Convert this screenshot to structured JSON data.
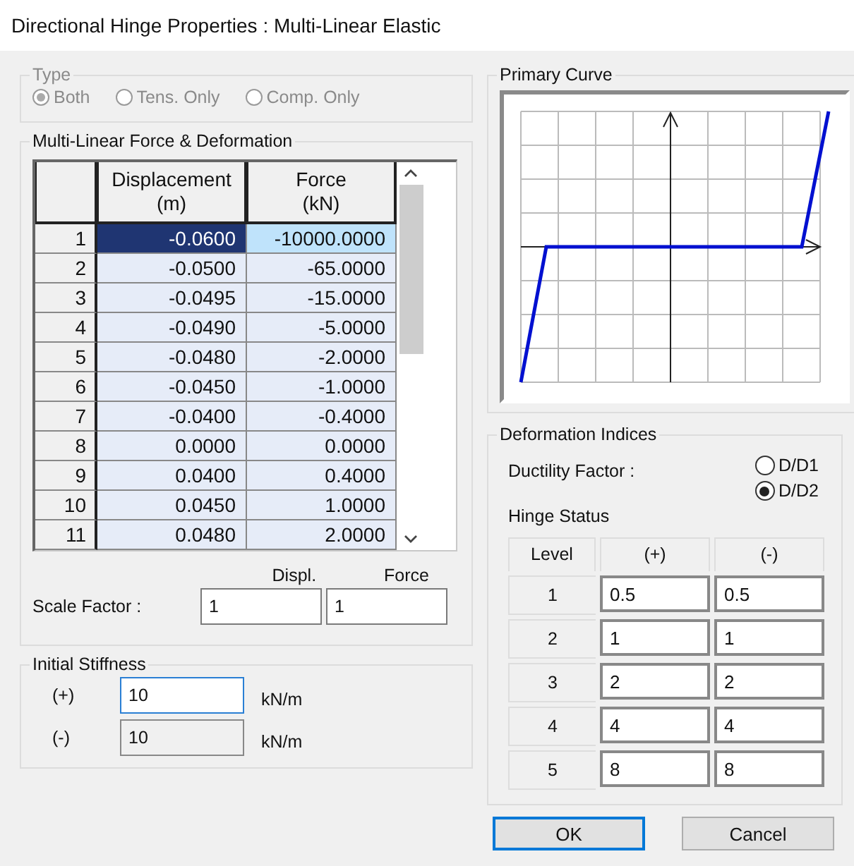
{
  "window": {
    "title": "Directional Hinge Properties : Multi-Linear Elastic"
  },
  "type_group": {
    "title": "Type",
    "disabled": true,
    "options": [
      {
        "label": "Both",
        "selected": true
      },
      {
        "label": "Tens. Only",
        "selected": false
      },
      {
        "label": "Comp. Only",
        "selected": false
      }
    ]
  },
  "table": {
    "title": "Multi-Linear Force & Deformation",
    "columns": [
      {
        "name": "Displacement",
        "unit": "(m)"
      },
      {
        "name": "Force",
        "unit": "(kN)"
      }
    ],
    "rows": [
      {
        "index": "1",
        "selected": true,
        "cells": [
          {
            "text": "-0.0600",
            "selected": true
          },
          {
            "text": "-10000.0000",
            "selected": false
          }
        ]
      },
      {
        "index": "2",
        "selected": false,
        "cells": [
          {
            "text": "-0.0500",
            "selected": false
          },
          {
            "text": "-65.0000",
            "selected": false
          }
        ]
      },
      {
        "index": "3",
        "selected": false,
        "cells": [
          {
            "text": "-0.0495",
            "selected": false
          },
          {
            "text": "-15.0000",
            "selected": false
          }
        ]
      },
      {
        "index": "4",
        "selected": false,
        "cells": [
          {
            "text": "-0.0490",
            "selected": false
          },
          {
            "text": "-5.0000",
            "selected": false
          }
        ]
      },
      {
        "index": "5",
        "selected": false,
        "cells": [
          {
            "text": "-0.0480",
            "selected": false
          },
          {
            "text": "-2.0000",
            "selected": false
          }
        ]
      },
      {
        "index": "6",
        "selected": false,
        "cells": [
          {
            "text": "-0.0450",
            "selected": false
          },
          {
            "text": "-1.0000",
            "selected": false
          }
        ]
      },
      {
        "index": "7",
        "selected": false,
        "cells": [
          {
            "text": "-0.0400",
            "selected": false
          },
          {
            "text": "-0.4000",
            "selected": false
          }
        ]
      },
      {
        "index": "8",
        "selected": false,
        "cells": [
          {
            "text": "0.0000",
            "selected": false
          },
          {
            "text": "0.0000",
            "selected": false
          }
        ]
      },
      {
        "index": "9",
        "selected": false,
        "cells": [
          {
            "text": "0.0400",
            "selected": false
          },
          {
            "text": "0.4000",
            "selected": false
          }
        ]
      },
      {
        "index": "10",
        "selected": false,
        "cells": [
          {
            "text": "0.0450",
            "selected": false
          },
          {
            "text": "1.0000",
            "selected": false
          }
        ]
      },
      {
        "index": "11",
        "selected": false,
        "cells": [
          {
            "text": "0.0480",
            "selected": false
          },
          {
            "text": "2.0000",
            "selected": false
          }
        ]
      }
    ]
  },
  "scale_factor": {
    "label": "Scale Factor :",
    "columns": [
      "Displ.",
      "Force"
    ],
    "values": [
      "1",
      "1"
    ]
  },
  "initial_stiffness": {
    "title": "Initial Stiffness",
    "rows": [
      {
        "label": "(+)",
        "value": "10",
        "focused": true,
        "disabled": false,
        "unit": "kN/m"
      },
      {
        "label": "(-)",
        "value": "10",
        "focused": false,
        "disabled": true,
        "unit": "kN/m"
      }
    ]
  },
  "primary_curve": {
    "title": "Primary Curve"
  },
  "deformation_indices": {
    "title": "Deformation Indices",
    "ductility_label": "Ductility Factor :",
    "options": [
      {
        "label": "D/D1",
        "selected": false
      },
      {
        "label": "D/D2",
        "selected": true
      }
    ],
    "hinge_status": {
      "title": "Hinge Status",
      "columns": [
        "Level",
        "(+)",
        "(-)"
      ],
      "rows": [
        {
          "level": "1",
          "plus": "0.5",
          "minus": "0.5"
        },
        {
          "level": "2",
          "plus": "1",
          "minus": "1"
        },
        {
          "level": "3",
          "plus": "2",
          "minus": "2"
        },
        {
          "level": "4",
          "plus": "4",
          "minus": "4"
        },
        {
          "level": "5",
          "plus": "8",
          "minus": "8"
        }
      ]
    }
  },
  "buttons": [
    {
      "label": "OK",
      "default": true
    },
    {
      "label": "Cancel",
      "default": false
    }
  ]
}
